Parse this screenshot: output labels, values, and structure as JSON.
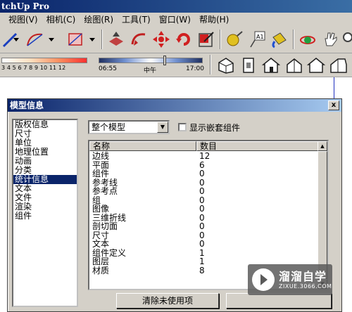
{
  "app": {
    "title": "tchUp Pro"
  },
  "menu": [
    "视图(V)",
    "相机(C)",
    "绘图(R)",
    "工具(T)",
    "窗口(W)",
    "帮助(H)"
  ],
  "toolbar2": {
    "shadow_numbers": "3 4 5 6 7 8 9 10 11 12",
    "time_start": "06:55",
    "time_mid": "中午",
    "time_end": "17:00"
  },
  "dialog": {
    "title": "模型信息",
    "close": "x",
    "nav": [
      "版权信息",
      "尺寸",
      "单位",
      "地理位置",
      "动画",
      "分类",
      "统计信息",
      "文本",
      "文件",
      "渲染",
      "组件"
    ],
    "selected_index": 6,
    "scope_dropdown": "整个模型",
    "nested_label": "显示嵌套组件",
    "table": {
      "headers": [
        "名称",
        "数目"
      ],
      "rows": [
        [
          "边线",
          "12"
        ],
        [
          "平面",
          "6"
        ],
        [
          "组件",
          "0"
        ],
        [
          "参考线",
          "0"
        ],
        [
          "参考点",
          "0"
        ],
        [
          "组",
          "0"
        ],
        [
          "图像",
          "0"
        ],
        [
          "三维折线",
          "0"
        ],
        [
          "剖切面",
          "0"
        ],
        [
          "尺寸",
          "0"
        ],
        [
          "文本",
          "0"
        ],
        [
          "组件定义",
          "1"
        ],
        [
          "图层",
          "1"
        ],
        [
          "材质",
          "8"
        ]
      ]
    },
    "purge_button": "清除未使用项"
  },
  "watermark": {
    "title": "溜溜自学",
    "sub": "ZIXUE.3066.COM"
  }
}
